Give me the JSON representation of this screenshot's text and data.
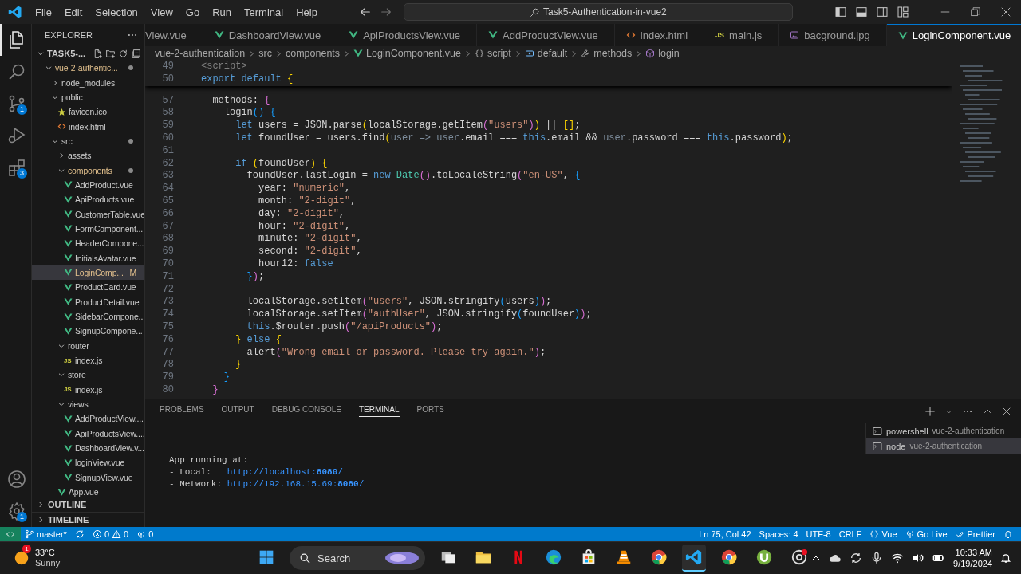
{
  "title_bar": {
    "menu": [
      "File",
      "Edit",
      "Selection",
      "View",
      "Go",
      "Run",
      "Terminal",
      "Help"
    ],
    "search": "Task5-Authentication-in-vue2"
  },
  "activity_bar": {
    "items": [
      {
        "kind": "explorer",
        "selected": true
      },
      {
        "kind": "search",
        "selected": false
      },
      {
        "kind": "source-control",
        "selected": false,
        "badge": "1"
      },
      {
        "kind": "run",
        "selected": false
      },
      {
        "kind": "extensions",
        "selected": false,
        "badge": "3"
      }
    ],
    "bottom": [
      {
        "kind": "account"
      },
      {
        "kind": "settings",
        "badge": "1"
      }
    ]
  },
  "sidebar": {
    "title": "EXPLORER",
    "workspace": "TASK5-...",
    "tree": [
      {
        "label": "vue-2-authentic...",
        "kind": "folder",
        "expanded": true,
        "changed": true,
        "dot": true,
        "selected": false,
        "children": [
          {
            "label": "node_modules",
            "kind": "folder",
            "expanded": false,
            "changed": false,
            "dot": false,
            "selected": false
          },
          {
            "label": "public",
            "kind": "folder",
            "expanded": true,
            "changed": false,
            "dot": false,
            "selected": false,
            "children": [
              {
                "label": "favicon.ico",
                "kind": "star",
                "changed": false,
                "selected": false
              },
              {
                "label": "index.html",
                "kind": "html",
                "changed": false,
                "selected": false
              }
            ]
          },
          {
            "label": "src",
            "kind": "folder",
            "expanded": true,
            "changed": false,
            "dot": true,
            "selected": false,
            "children": [
              {
                "label": "assets",
                "kind": "folder",
                "expanded": false,
                "changed": false,
                "dot": false,
                "selected": false
              },
              {
                "label": "components",
                "kind": "folder",
                "expanded": true,
                "changed": true,
                "dot": true,
                "selected": false,
                "children": [
                  {
                    "label": "AddProduct.vue",
                    "kind": "vue",
                    "changed": false,
                    "selected": false
                  },
                  {
                    "label": "ApiProducts.vue",
                    "kind": "vue",
                    "changed": false,
                    "selected": false
                  },
                  {
                    "label": "CustomerTable.vue",
                    "kind": "vue",
                    "changed": false,
                    "selected": false
                  },
                  {
                    "label": "FormComponent....",
                    "kind": "vue",
                    "changed": false,
                    "selected": false
                  },
                  {
                    "label": "HeaderCompone...",
                    "kind": "vue",
                    "changed": false,
                    "selected": false
                  },
                  {
                    "label": "InitialsAvatar.vue",
                    "kind": "vue",
                    "changed": false,
                    "selected": false
                  },
                  {
                    "label": "LoginComp...",
                    "kind": "vue",
                    "changed": true,
                    "status": "M",
                    "selected": true
                  },
                  {
                    "label": "ProductCard.vue",
                    "kind": "vue",
                    "changed": false,
                    "selected": false
                  },
                  {
                    "label": "ProductDetail.vue",
                    "kind": "vue",
                    "changed": false,
                    "selected": false
                  },
                  {
                    "label": "SidebarCompone...",
                    "kind": "vue",
                    "changed": false,
                    "selected": false
                  },
                  {
                    "label": "SignupCompone...",
                    "kind": "vue",
                    "changed": false,
                    "selected": false
                  }
                ]
              },
              {
                "label": "router",
                "kind": "folder",
                "expanded": true,
                "changed": false,
                "dot": false,
                "selected": false,
                "children": [
                  {
                    "label": "index.js",
                    "kind": "js",
                    "icon_label": "JS",
                    "changed": false,
                    "selected": false
                  }
                ]
              },
              {
                "label": "store",
                "kind": "folder",
                "expanded": true,
                "changed": false,
                "dot": false,
                "selected": false,
                "children": [
                  {
                    "label": "index.js",
                    "kind": "js",
                    "icon_label": "JS",
                    "changed": false,
                    "selected": false
                  }
                ]
              },
              {
                "label": "views",
                "kind": "folder",
                "expanded": true,
                "changed": false,
                "dot": false,
                "selected": false,
                "children": [
                  {
                    "label": "AddProductView....",
                    "kind": "vue",
                    "changed": false,
                    "selected": false
                  },
                  {
                    "label": "ApiProductsView....",
                    "kind": "vue",
                    "changed": false,
                    "selected": false
                  },
                  {
                    "label": "DashboardView.v...",
                    "kind": "vue",
                    "changed": false,
                    "selected": false
                  },
                  {
                    "label": "loginView.vue",
                    "kind": "vue",
                    "changed": false,
                    "selected": false
                  },
                  {
                    "label": "SignupView.vue",
                    "kind": "vue",
                    "changed": false,
                    "selected": false
                  }
                ]
              },
              {
                "label": "App.vue",
                "kind": "vue",
                "changed": false,
                "selected": false
              }
            ]
          }
        ]
      }
    ],
    "sections": [
      "OUTLINE",
      "TIMELINE"
    ]
  },
  "tabs": [
    {
      "label": "View.vue",
      "kind": "none",
      "selected": false
    },
    {
      "label": "DashboardView.vue",
      "kind": "vue",
      "selected": false
    },
    {
      "label": "ApiProductsView.vue",
      "kind": "vue",
      "selected": false
    },
    {
      "label": "AddProductView.vue",
      "kind": "vue",
      "selected": false
    },
    {
      "label": "index.html",
      "kind": "html",
      "selected": false
    },
    {
      "label": "main.js",
      "kind": "js",
      "icon_label": "JS",
      "selected": false
    },
    {
      "label": "bacground.jpg",
      "kind": "image",
      "selected": false
    },
    {
      "label": "LoginComponent.vue",
      "kind": "vue",
      "selected": true
    }
  ],
  "breadcrumbs": [
    {
      "label": "vue-2-authentication",
      "kind": "folder"
    },
    {
      "label": "src",
      "kind": "folder"
    },
    {
      "label": "components",
      "kind": "folder"
    },
    {
      "label": "LoginComponent.vue",
      "kind": "vue"
    },
    {
      "label": "script",
      "kind": "braces"
    },
    {
      "label": "default",
      "kind": "variable"
    },
    {
      "label": "methods",
      "kind": "wrench"
    },
    {
      "label": "login",
      "kind": "cube"
    }
  ],
  "editor": {
    "sticky": [
      {
        "number": "49",
        "tokens": [
          {
            "text": "<script>",
            "kind": "tag"
          }
        ]
      },
      {
        "number": "50",
        "tokens": [
          {
            "text": "export default ",
            "kind": "keyword"
          },
          {
            "text": "{",
            "kind": "bracket1"
          }
        ]
      }
    ],
    "lines": [
      {
        "number": "57",
        "tokens": [
          {
            "text": "methods: ",
            "kind": "plain"
          },
          {
            "text": "{",
            "kind": "bracket2"
          }
        ]
      },
      {
        "number": "58",
        "tokens": [
          {
            "text": "login",
            "kind": "plain"
          },
          {
            "text": "() ",
            "kind": "bracket3"
          },
          {
            "text": "{",
            "kind": "bracket3"
          }
        ]
      },
      {
        "number": "59",
        "tokens": [
          {
            "text": "let",
            "kind": "keyword"
          },
          {
            "text": " users = JSON.parse",
            "kind": "plain"
          },
          {
            "text": "(",
            "kind": "bracket1"
          },
          {
            "text": "localStorage.getItem",
            "kind": "plain"
          },
          {
            "text": "(",
            "kind": "bracket2"
          },
          {
            "text": "\"users\"",
            "kind": "string"
          },
          {
            "text": ")",
            "kind": "bracket2"
          },
          {
            "text": ")",
            "kind": "bracket1"
          },
          {
            "text": " || ",
            "kind": "plain"
          },
          {
            "text": "[]",
            "kind": "bracket1"
          },
          {
            "text": ";",
            "kind": "plain"
          }
        ]
      },
      {
        "number": "60",
        "tokens": [
          {
            "text": "let",
            "kind": "keyword"
          },
          {
            "text": " foundUser = users.find",
            "kind": "plain"
          },
          {
            "text": "(",
            "kind": "bracket1"
          },
          {
            "text": "user => user",
            "kind": "dim"
          },
          {
            "text": ".email === ",
            "kind": "plain"
          },
          {
            "text": "this",
            "kind": "keyword"
          },
          {
            "text": ".email && ",
            "kind": "plain"
          },
          {
            "text": "user",
            "kind": "dim"
          },
          {
            "text": ".password === ",
            "kind": "plain"
          },
          {
            "text": "this",
            "kind": "keyword"
          },
          {
            "text": ".password",
            "kind": "plain"
          },
          {
            "text": ")",
            "kind": "bracket1"
          },
          {
            "text": ";",
            "kind": "plain"
          }
        ]
      },
      {
        "number": "61"
      },
      {
        "number": "62",
        "tokens": [
          {
            "text": "if ",
            "kind": "keyword"
          },
          {
            "text": "(",
            "kind": "bracket1"
          },
          {
            "text": "foundUser",
            "kind": "plain"
          },
          {
            "text": ") {",
            "kind": "bracket1"
          }
        ]
      },
      {
        "number": "63",
        "tokens": [
          {
            "text": "foundUser.lastLogin = ",
            "kind": "plain"
          },
          {
            "text": "new ",
            "kind": "keyword"
          },
          {
            "text": "Date",
            "kind": "type"
          },
          {
            "text": "()",
            "kind": "bracket2"
          },
          {
            "text": ".toLocaleString",
            "kind": "plain"
          },
          {
            "text": "(",
            "kind": "bracket2"
          },
          {
            "text": "\"en-US\"",
            "kind": "string"
          },
          {
            "text": ", ",
            "kind": "plain"
          },
          {
            "text": "{",
            "kind": "bracket3"
          }
        ]
      },
      {
        "number": "64",
        "tokens": [
          {
            "text": "year: ",
            "kind": "plain"
          },
          {
            "text": "\"numeric\"",
            "kind": "string"
          },
          {
            "text": ",",
            "kind": "plain"
          }
        ]
      },
      {
        "number": "65",
        "tokens": [
          {
            "text": "month: ",
            "kind": "plain"
          },
          {
            "text": "\"2-digit\"",
            "kind": "string"
          },
          {
            "text": ",",
            "kind": "plain"
          }
        ]
      },
      {
        "number": "66",
        "tokens": [
          {
            "text": "day: ",
            "kind": "plain"
          },
          {
            "text": "\"2-digit\"",
            "kind": "string"
          },
          {
            "text": ",",
            "kind": "plain"
          }
        ]
      },
      {
        "number": "67",
        "tokens": [
          {
            "text": "hour: ",
            "kind": "plain"
          },
          {
            "text": "\"2-digit\"",
            "kind": "string"
          },
          {
            "text": ",",
            "kind": "plain"
          }
        ]
      },
      {
        "number": "68",
        "tokens": [
          {
            "text": "minute: ",
            "kind": "plain"
          },
          {
            "text": "\"2-digit\"",
            "kind": "string"
          },
          {
            "text": ",",
            "kind": "plain"
          }
        ]
      },
      {
        "number": "69",
        "tokens": [
          {
            "text": "second: ",
            "kind": "plain"
          },
          {
            "text": "\"2-digit\"",
            "kind": "string"
          },
          {
            "text": ",",
            "kind": "plain"
          }
        ]
      },
      {
        "number": "70",
        "tokens": [
          {
            "text": "hour12: ",
            "kind": "plain"
          },
          {
            "text": "false",
            "kind": "keyword"
          }
        ]
      },
      {
        "number": "71",
        "tokens": [
          {
            "text": "}",
            "kind": "bracket3"
          },
          {
            "text": ")",
            "kind": "bracket2"
          },
          {
            "text": ";",
            "kind": "plain"
          }
        ]
      },
      {
        "number": "72"
      },
      {
        "number": "73",
        "tokens": [
          {
            "text": "localStorage.setItem",
            "kind": "plain"
          },
          {
            "text": "(",
            "kind": "bracket2"
          },
          {
            "text": "\"users\"",
            "kind": "string"
          },
          {
            "text": ", JSON.stringify",
            "kind": "plain"
          },
          {
            "text": "(",
            "kind": "bracket3"
          },
          {
            "text": "users",
            "kind": "plain"
          },
          {
            "text": ")",
            "kind": "bracket3"
          },
          {
            "text": ")",
            "kind": "bracket2"
          },
          {
            "text": ";",
            "kind": "plain"
          }
        ]
      },
      {
        "number": "74",
        "tokens": [
          {
            "text": "localStorage.setItem",
            "kind": "plain"
          },
          {
            "text": "(",
            "kind": "bracket2"
          },
          {
            "text": "\"authUser\"",
            "kind": "string"
          },
          {
            "text": ", JSON.stringify",
            "kind": "plain"
          },
          {
            "text": "(",
            "kind": "bracket3"
          },
          {
            "text": "foundUser",
            "kind": "plain"
          },
          {
            "text": ")",
            "kind": "bracket3"
          },
          {
            "text": ")",
            "kind": "bracket2"
          },
          {
            "text": ";",
            "kind": "plain"
          }
        ]
      },
      {
        "number": "75",
        "tokens": [
          {
            "text": "this",
            "kind": "keyword"
          },
          {
            "text": ".$router.push",
            "kind": "plain"
          },
          {
            "text": "(",
            "kind": "bracket2"
          },
          {
            "text": "\"/apiProducts\"",
            "kind": "string"
          },
          {
            "text": ")",
            "kind": "bracket2"
          },
          {
            "text": ";",
            "kind": "plain"
          }
        ]
      },
      {
        "number": "76",
        "tokens": [
          {
            "text": "} ",
            "kind": "bracket1"
          },
          {
            "text": "else ",
            "kind": "keyword"
          },
          {
            "text": "{",
            "kind": "bracket1"
          }
        ]
      },
      {
        "number": "77",
        "tokens": [
          {
            "text": "alert",
            "kind": "plain"
          },
          {
            "text": "(",
            "kind": "bracket2"
          },
          {
            "text": "\"Wrong email or password. Please try again.\"",
            "kind": "string"
          },
          {
            "text": ")",
            "kind": "bracket2"
          },
          {
            "text": ";",
            "kind": "plain"
          }
        ]
      },
      {
        "number": "78",
        "tokens": [
          {
            "text": "}",
            "kind": "bracket1"
          }
        ]
      },
      {
        "number": "79",
        "tokens": [
          {
            "text": "}",
            "kind": "bracket3"
          }
        ]
      },
      {
        "number": "80",
        "tokens": [
          {
            "text": "}",
            "kind": "bracket2"
          }
        ]
      }
    ]
  },
  "panel": {
    "tabs": [
      {
        "label": "PROBLEMS",
        "selected": false
      },
      {
        "label": "OUTPUT",
        "selected": false
      },
      {
        "label": "DEBUG CONSOLE",
        "selected": false
      },
      {
        "label": "TERMINAL",
        "selected": true
      },
      {
        "label": "PORTS",
        "selected": false
      }
    ],
    "output": [
      [
        {
          "text": "App running at:",
          "kind": "plain"
        }
      ],
      [
        {
          "text": "- Local:   ",
          "kind": "plain"
        },
        {
          "text": "http://localhost:",
          "kind": "link"
        },
        {
          "text": "8080",
          "kind": "port"
        },
        {
          "text": "/",
          "kind": "link"
        }
      ],
      [
        {
          "text": "- Network: ",
          "kind": "plain"
        },
        {
          "text": "http://192.168.15.69:",
          "kind": "link"
        },
        {
          "text": "8080",
          "kind": "port"
        },
        {
          "text": "/",
          "kind": "link"
        }
      ]
    ],
    "terminals": [
      {
        "name": "powershell",
        "folder": "vue-2-authentication",
        "selected": false
      },
      {
        "name": "node",
        "folder": "vue-2-authentication",
        "selected": true
      }
    ]
  },
  "status_bar": {
    "left": [
      {
        "kind": "remote"
      },
      {
        "kind": "branch",
        "text": "master*"
      },
      {
        "kind": "sync"
      },
      {
        "kind": "problems",
        "errors": "0",
        "warnings": "0"
      },
      {
        "kind": "ports",
        "text": "0"
      }
    ],
    "right": [
      {
        "kind": "text",
        "text": "Ln 75, Col 42"
      },
      {
        "kind": "text",
        "text": "Spaces: 4"
      },
      {
        "kind": "text",
        "text": "UTF-8"
      },
      {
        "kind": "text",
        "text": "CRLF"
      },
      {
        "kind": "language",
        "text": "Vue"
      },
      {
        "kind": "golive",
        "text": "Go Live"
      },
      {
        "kind": "prettier",
        "text": "Prettier"
      },
      {
        "kind": "bell"
      }
    ]
  },
  "taskbar": {
    "weather": {
      "temp": "33°C",
      "condition": "Sunny",
      "badge": "1"
    },
    "search": "Search",
    "apps": [
      {
        "kind": "taskview",
        "selected": false
      },
      {
        "kind": "folder",
        "selected": false
      },
      {
        "kind": "redapp",
        "selected": false
      },
      {
        "kind": "edge",
        "selected": false
      },
      {
        "kind": "store",
        "selected": false
      },
      {
        "kind": "cone",
        "selected": false
      },
      {
        "kind": "chrome",
        "selected": false
      },
      {
        "kind": "vscode",
        "selected": true
      },
      {
        "kind": "chrome",
        "selected": false
      },
      {
        "kind": "greenapp",
        "selected": false
      },
      {
        "kind": "chromered",
        "selected": false
      }
    ],
    "clock": {
      "time": "10:33 AM",
      "date": "9/19/2024"
    }
  }
}
